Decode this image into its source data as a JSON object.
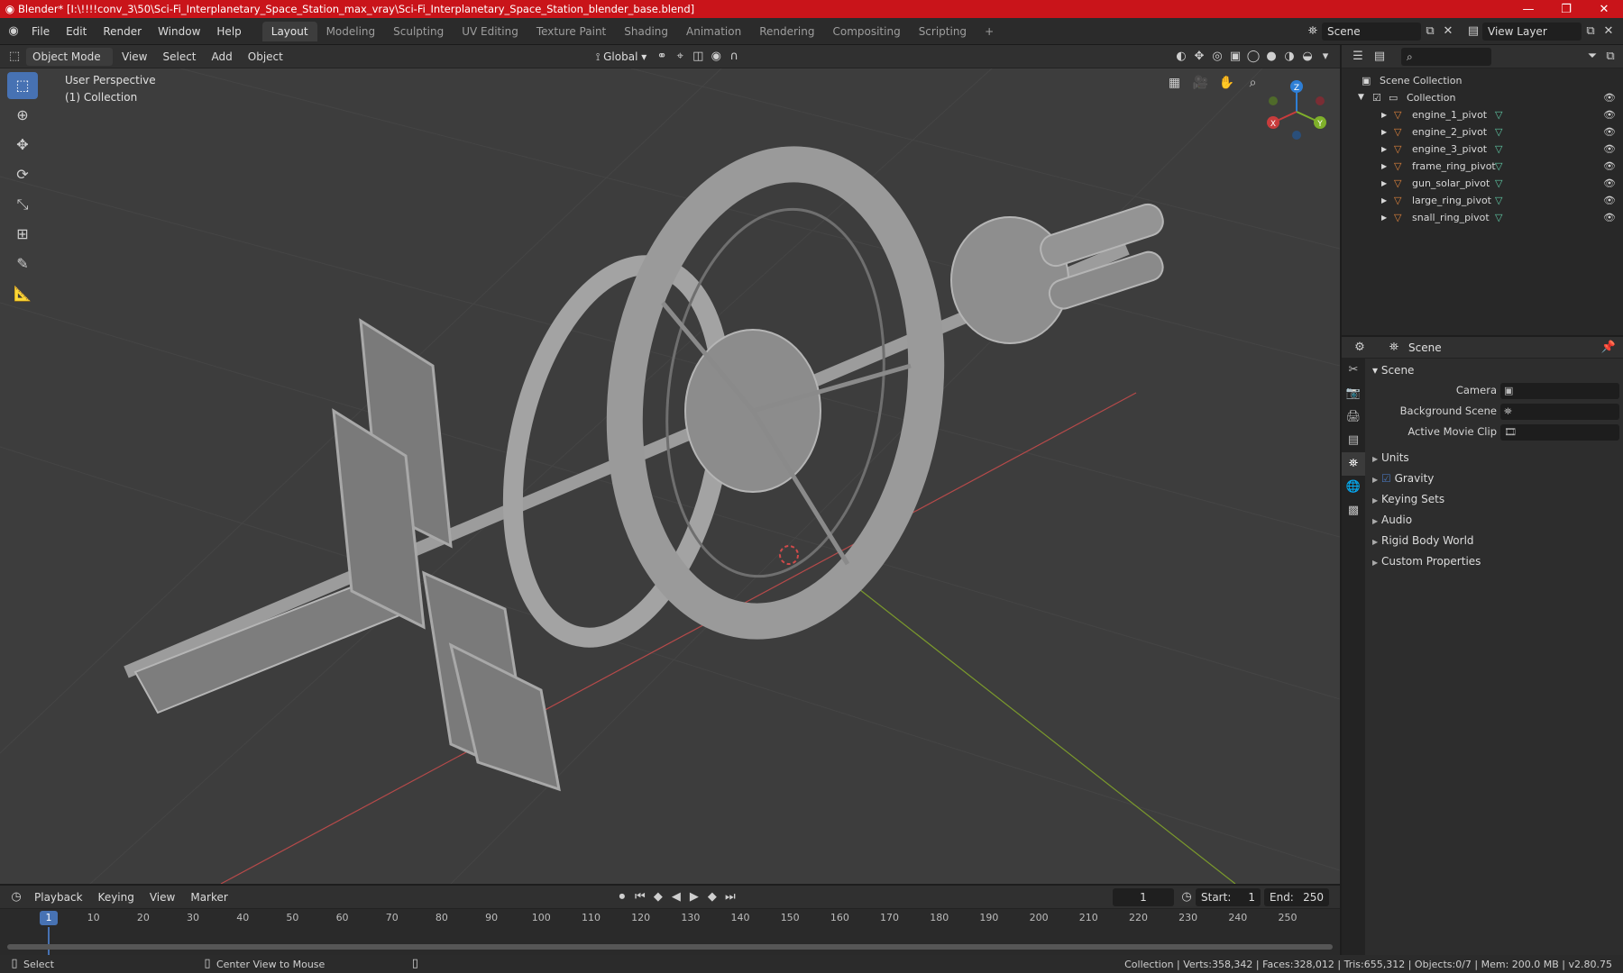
{
  "window": {
    "title": "Blender* [I:\\!!!!conv_3\\50\\Sci-Fi_Interplanetary_Space_Station_max_vray\\Sci-Fi_Interplanetary_Space_Station_blender_base.blend]",
    "minimize_icon": "minimize-icon",
    "maximize_icon": "maximize-icon",
    "close_icon": "close-icon"
  },
  "menus": [
    "File",
    "Edit",
    "Render",
    "Window",
    "Help"
  ],
  "workspaces": [
    {
      "label": "Layout",
      "active": true
    },
    {
      "label": "Modeling",
      "active": false
    },
    {
      "label": "Sculpting",
      "active": false
    },
    {
      "label": "UV Editing",
      "active": false
    },
    {
      "label": "Texture Paint",
      "active": false
    },
    {
      "label": "Shading",
      "active": false
    },
    {
      "label": "Animation",
      "active": false
    },
    {
      "label": "Rendering",
      "active": false
    },
    {
      "label": "Compositing",
      "active": false
    },
    {
      "label": "Scripting",
      "active": false
    }
  ],
  "add_workspace": "+",
  "scene_selector": {
    "value": "Scene"
  },
  "view_layer_selector": {
    "value": "View Layer"
  },
  "viewport_header": {
    "mode": "Object Mode",
    "menus": [
      "View",
      "Select",
      "Add",
      "Object"
    ],
    "orientation": "Global"
  },
  "viewport": {
    "perspective": "User Perspective",
    "collection": "(1) Collection",
    "axes": {
      "x": "X",
      "y": "Y",
      "z": "Z"
    },
    "colors": {
      "x_axis": "#c83c3c",
      "y_axis": "#7fb02a",
      "z_axis": "#2e7fd6",
      "background": "#3d3d3d"
    }
  },
  "outliner": {
    "root": "Scene Collection",
    "collection": "Collection",
    "items": [
      "engine_1_pivot",
      "engine_2_pivot",
      "engine_3_pivot",
      "frame_ring_pivot",
      "gun_solar_pivot",
      "large_ring_pivot",
      "snall_ring_pivot"
    ]
  },
  "properties": {
    "context": "Scene",
    "section": "Scene",
    "fields": [
      {
        "label": "Camera"
      },
      {
        "label": "Background Scene"
      },
      {
        "label": "Active Movie Clip"
      }
    ],
    "panels": [
      {
        "label": "Units",
        "checkbox": false
      },
      {
        "label": "Gravity",
        "checkbox": true
      },
      {
        "label": "Keying Sets",
        "checkbox": false
      },
      {
        "label": "Audio",
        "checkbox": false
      },
      {
        "label": "Rigid Body World",
        "checkbox": false
      },
      {
        "label": "Custom Properties",
        "checkbox": false
      }
    ]
  },
  "timeline": {
    "menus": [
      "Playback",
      "Keying",
      "View",
      "Marker"
    ],
    "current_frame": "1",
    "start_label": "Start:",
    "start": "1",
    "end_label": "End:",
    "end": "250",
    "ruler": [
      1,
      10,
      20,
      30,
      40,
      50,
      60,
      70,
      80,
      90,
      100,
      110,
      120,
      130,
      140,
      150,
      160,
      170,
      180,
      190,
      200,
      210,
      220,
      230,
      240,
      250
    ]
  },
  "statusbar": {
    "select": "Select",
    "center_view": "Center View to Mouse",
    "stats": "Collection | Verts:358,342 | Faces:328,012 | Tris:655,312 | Objects:0/7 | Mem: 200.0 MB | v2.80.75"
  }
}
